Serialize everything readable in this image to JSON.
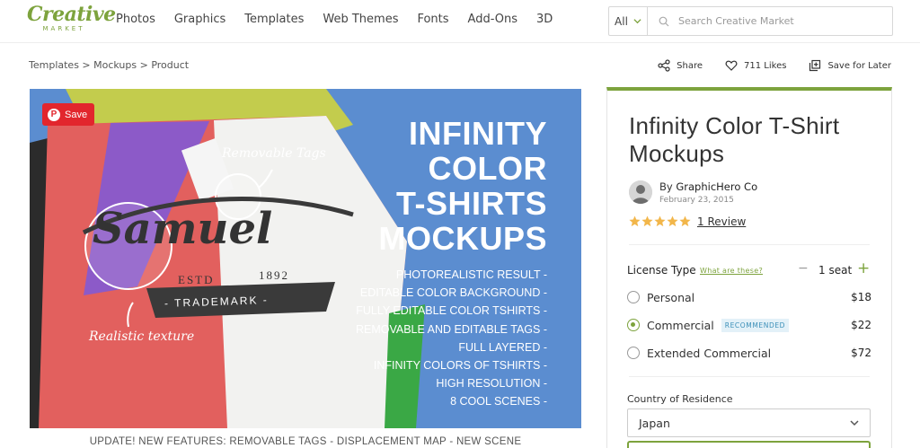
{
  "header": {
    "logo_main": "Creative",
    "logo_sub": "MARKET",
    "nav": [
      "Photos",
      "Graphics",
      "Templates",
      "Web Themes",
      "Fonts",
      "Add-Ons",
      "3D"
    ],
    "search_category": "All",
    "search_placeholder": "Search Creative Market"
  },
  "breadcrumb": "Templates > Mockups > Product",
  "actions": {
    "share": "Share",
    "likes": "711 Likes",
    "save_later": "Save for Later"
  },
  "image": {
    "pin_save": "Save",
    "headline": [
      "INFINITY",
      "COLOR",
      "T-SHIRTS",
      "MOCKUPS"
    ],
    "features": [
      "PHOTOREALISTIC RESULT -",
      "EDITABLE COLOR BACKGROUND -",
      "FULLY EDITABLE COLOR TSHIRTS -",
      "REMOVABLE AND EDITABLE TAGS -",
      "FULL LAYERED -",
      "INFINITY COLORS OF TSHIRTS -",
      "HIGH RESOLUTION -",
      "8 COOL SCENES -"
    ],
    "label_tags": "Removable Tags",
    "label_texture": "Realistic texture",
    "shirt_script": "Samuel",
    "shirt_estd": "ESTD",
    "shirt_year": "1892",
    "shirt_trademark": "- TRADEMARK -",
    "colors": {
      "background": "#5b8dd0",
      "shirt_red": "#e2605e",
      "shirt_purple": "#8c5ac8",
      "shirt_green": "#c3cc4d",
      "shirt_white": "#f2f2f0"
    }
  },
  "caption": "UPDATE! NEW FEATURES: REMOVABLE TAGS - DISPLACEMENT MAP - NEW SCENE",
  "product": {
    "title": "Infinity Color T-Shirt Mockups",
    "by_prefix": "By",
    "author": "GraphicHero Co",
    "date": "February 23, 2015",
    "rating": 5,
    "review_link": "1 Review",
    "license_label": "License Type",
    "license_help": "What are these?",
    "seats": "1 seat",
    "licenses": [
      {
        "name": "Personal",
        "price": "$18",
        "selected": false,
        "badge": ""
      },
      {
        "name": "Commercial",
        "price": "$22",
        "selected": true,
        "badge": "RECOMMENDED"
      },
      {
        "name": "Extended Commercial",
        "price": "$72",
        "selected": false,
        "badge": ""
      }
    ],
    "country_label": "Country of Residence",
    "country_value": "Japan",
    "accent_color": "#7da33d"
  }
}
